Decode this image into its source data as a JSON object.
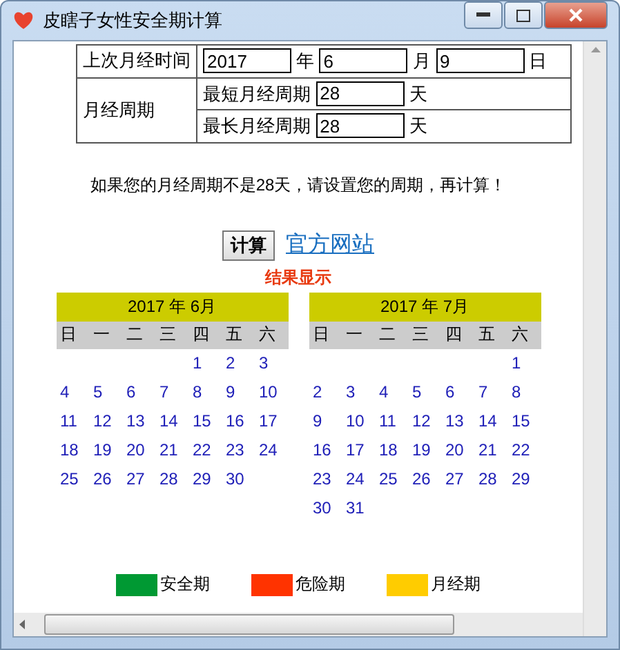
{
  "window": {
    "title": "皮瞎子女性安全期计算"
  },
  "form": {
    "last_period": {
      "label": "上次月经时间",
      "fields": [
        {
          "value": "2017",
          "unit": "年"
        },
        {
          "value": "6",
          "unit": "月"
        },
        {
          "value": "9",
          "unit": "日"
        }
      ]
    },
    "cycle": {
      "label": "月经周期",
      "rows": [
        {
          "label": "最短月经周期",
          "value": "28",
          "unit": "天"
        },
        {
          "label": "最长月经周期",
          "value": "28",
          "unit": "天"
        }
      ]
    }
  },
  "hint": "如果您的月经周期不是28天，请设置您的周期，再计算！",
  "calculate_button": "计算",
  "website_link": "官方网站",
  "result_title": "结果显示",
  "calendars": [
    {
      "title": "2017 年  6月",
      "weekdays": [
        "日",
        "一",
        "二",
        "三",
        "四",
        "五",
        "六"
      ],
      "weeks": [
        [
          "1",
          "2",
          "3"
        ],
        [
          "4",
          "5",
          "6",
          "7",
          "8",
          "9",
          "10"
        ],
        [
          "11",
          "12",
          "13",
          "14",
          "15",
          "16",
          "17"
        ],
        [
          "18",
          "19",
          "20",
          "21",
          "22",
          "23",
          "24"
        ],
        [
          "25",
          "26",
          "27",
          "28",
          "29",
          "30"
        ]
      ]
    },
    {
      "title": "2017 年  7月",
      "weekdays": [
        "日",
        "一",
        "二",
        "三",
        "四",
        "五",
        "六"
      ],
      "weeks": [
        [
          "1"
        ],
        [
          "2",
          "3",
          "4",
          "5",
          "6",
          "7",
          "8"
        ],
        [
          "9",
          "10",
          "11",
          "12",
          "13",
          "14",
          "15"
        ],
        [
          "16",
          "17",
          "18",
          "19",
          "20",
          "21",
          "22"
        ],
        [
          "23",
          "24",
          "25",
          "26",
          "27",
          "28",
          "29"
        ],
        [
          "30",
          "31"
        ]
      ]
    }
  ],
  "legend": [
    {
      "label": "安全期",
      "color": "#009933"
    },
    {
      "label": "危险期",
      "color": "#ff3300"
    },
    {
      "label": "月经期",
      "color": "#ffcc00"
    }
  ]
}
